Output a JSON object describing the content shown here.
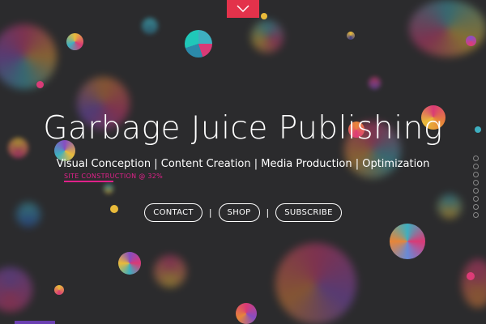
{
  "header": {
    "menu_icon": "chevron-down-icon",
    "accent": "#e3324b"
  },
  "hero": {
    "title": "Garbage Juice Publishing",
    "tagline": "Visual Conception | Content Creation | Media Production | Optimization"
  },
  "progress": {
    "label": "SITE CONSTRUCTION @ 32%",
    "percent": 32,
    "color": "#e0218a"
  },
  "nav": {
    "contact": "CONTACT",
    "shop": "SHOP",
    "subscribe": "SUBSCRIBE",
    "separator": "|"
  },
  "section_dots": {
    "count": 8
  }
}
